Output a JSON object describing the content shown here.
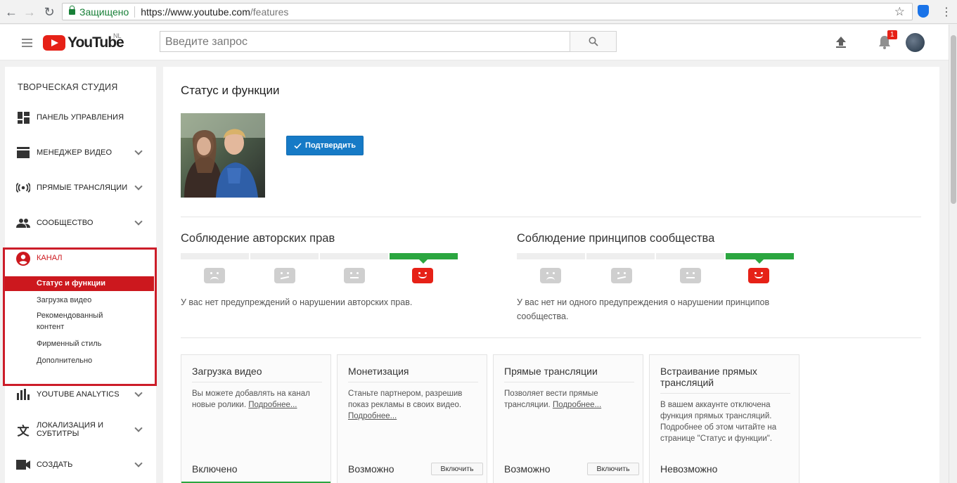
{
  "browser": {
    "secure_label": "Защищено",
    "url_scheme": "https://www.youtube.com",
    "url_path": "/features"
  },
  "header": {
    "logo_text": "YouTube",
    "region": "NL",
    "search_placeholder": "Введите запрос",
    "notification_count": "1"
  },
  "sidebar": {
    "title": "ТВОРЧЕСКАЯ СТУДИЯ",
    "items": [
      {
        "label": "ПАНЕЛЬ УПРАВЛЕНИЯ",
        "icon": "dashboard-icon"
      },
      {
        "label": "МЕНЕДЖЕР ВИДЕО",
        "icon": "video-manager-icon"
      },
      {
        "label": "ПРЯМЫЕ ТРАНСЛЯЦИИ",
        "icon": "live-icon"
      },
      {
        "label": "СООБЩЕСТВО",
        "icon": "community-icon"
      },
      {
        "label": "КАНАЛ",
        "icon": "channel-icon"
      },
      {
        "label": "YOUTUBE ANALYTICS",
        "icon": "analytics-icon"
      },
      {
        "label": "ЛОКАЛИЗАЦИЯ И СУБТИТРЫ",
        "icon": "translate-icon"
      },
      {
        "label": "СОЗДАТЬ",
        "icon": "create-icon"
      }
    ],
    "channel_subitems": [
      "Статус и функции",
      "Загрузка видео",
      "Рекомендованный контент",
      "Фирменный стиль",
      "Дополнительно"
    ]
  },
  "main": {
    "title": "Статус и функции",
    "verify_label": "Подтвердить",
    "copyright": {
      "title": "Соблюдение авторских прав",
      "text": "У вас нет предупреждений о нарушении авторских прав."
    },
    "community": {
      "title": "Соблюдение принципов сообщества",
      "text": "У вас нет ни одного предупреждения о нарушении принципов сообщества."
    },
    "cards": [
      {
        "title": "Загрузка видео",
        "text": "Вы можете добавлять на канал новые ролики.",
        "more": "Подробнее...",
        "status": "Включено",
        "button": ""
      },
      {
        "title": "Монетизация",
        "text": "Станьте партнером, разрешив показ рекламы в своих видео.",
        "more": "Подробнее...",
        "status": "Возможно",
        "button": "Включить"
      },
      {
        "title": "Прямые трансляции",
        "text": "Позволяет вести прямые трансляции.",
        "more": "Подробнее...",
        "status": "Возможно",
        "button": "Включить"
      },
      {
        "title": "Встраивание прямых трансляций",
        "text": "В вашем аккаунте отключена функция прямых трансляций. Подробнее об этом читайте на странице \"Статус и функции\".",
        "more": "",
        "status": "Невозможно",
        "button": ""
      }
    ]
  },
  "colors": {
    "youtube_red": "#e62117",
    "channel_highlight": "#cc181e",
    "verify_blue": "#167ac6",
    "status_green": "#2ba640"
  }
}
